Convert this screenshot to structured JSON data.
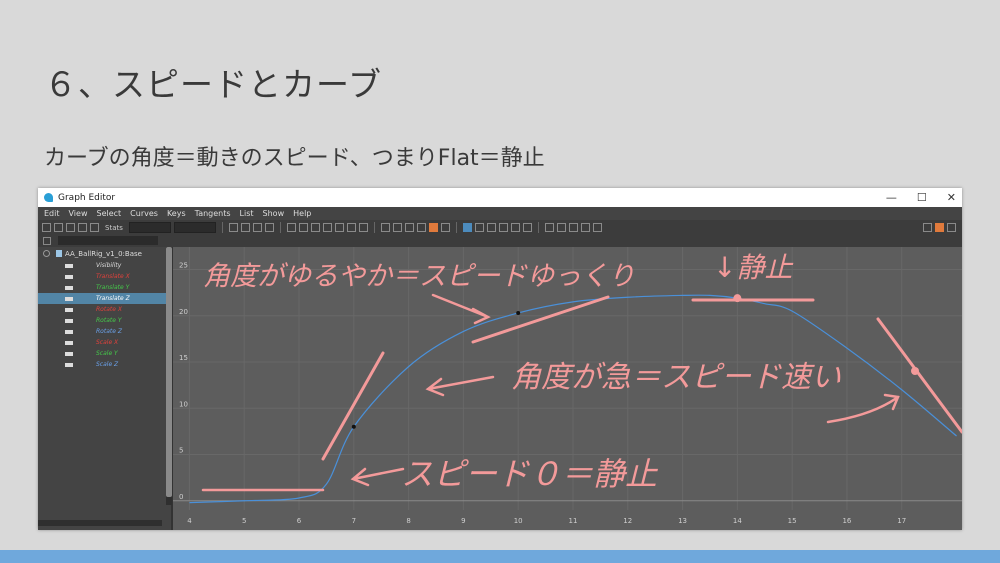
{
  "slide": {
    "title": "６、スピードとカーブ",
    "subtitle": "カーブの角度＝動きのスピード、つまりFlat＝静止"
  },
  "window": {
    "title": "Graph Editor",
    "controls": [
      "—",
      "☐",
      "✕"
    ]
  },
  "menu": [
    "Edit",
    "View",
    "Select",
    "Curves",
    "Keys",
    "Tangents",
    "List",
    "Show",
    "Help"
  ],
  "toolbar": {
    "stats_label": "Stats"
  },
  "outliner": {
    "root": "AA_BallRig_v1_0:Base",
    "channels": [
      {
        "label": "Visibility",
        "color": "#dddddd"
      },
      {
        "label": "Translate X",
        "color": "#e0413b"
      },
      {
        "label": "Translate Y",
        "color": "#44c84a"
      },
      {
        "label": "Translate Z",
        "color": "#ffffff",
        "selected": true
      },
      {
        "label": "Rotate X",
        "color": "#e0413b"
      },
      {
        "label": "Rotate Y",
        "color": "#44c84a"
      },
      {
        "label": "Rotate Z",
        "color": "#6aa0e8"
      },
      {
        "label": "Scale X",
        "color": "#e0413b"
      },
      {
        "label": "Scale Y",
        "color": "#44c84a"
      },
      {
        "label": "Scale Z",
        "color": "#6aa0e8"
      }
    ]
  },
  "chart_data": {
    "type": "line",
    "x_ticks": [
      "4",
      "5",
      "6",
      "7",
      "8",
      "9",
      "10",
      "11",
      "12",
      "13",
      "14",
      "15",
      "16",
      "17"
    ],
    "y_ticks": [
      "0",
      "5",
      "10",
      "15",
      "20",
      "25"
    ],
    "xlim": [
      3.7,
      18.1
    ],
    "ylim": [
      -1,
      27
    ],
    "grid": true,
    "series": [
      {
        "color": "#4a90d9",
        "x": [
          4,
          5,
          6,
          6.5,
          7,
          8,
          9,
          10,
          11,
          12,
          13,
          13.5,
          14,
          14.5,
          15,
          16,
          17,
          18
        ],
        "y": [
          -0.2,
          0,
          0.3,
          1.8,
          8,
          14.5,
          18.3,
          20.3,
          21.5,
          22.0,
          22.2,
          22.2,
          21.9,
          21.3,
          20.5,
          16.5,
          12,
          7
        ]
      }
    ],
    "keys": [
      {
        "x": 7,
        "y": 8
      },
      {
        "x": 10,
        "y": 20.3
      },
      {
        "x": 14,
        "y": 21.9
      }
    ]
  },
  "annotations": {
    "top_left": "角度がゆるやか＝スピードゆっくり",
    "top_right": "↓静止",
    "middle": "角度が急＝スピード速い",
    "bottom": "スピード０＝静止"
  },
  "colors": {
    "annotation": "#f39a9a",
    "graph_bg": "#5d5d5d",
    "accent_bar": "#6fa8dc"
  }
}
